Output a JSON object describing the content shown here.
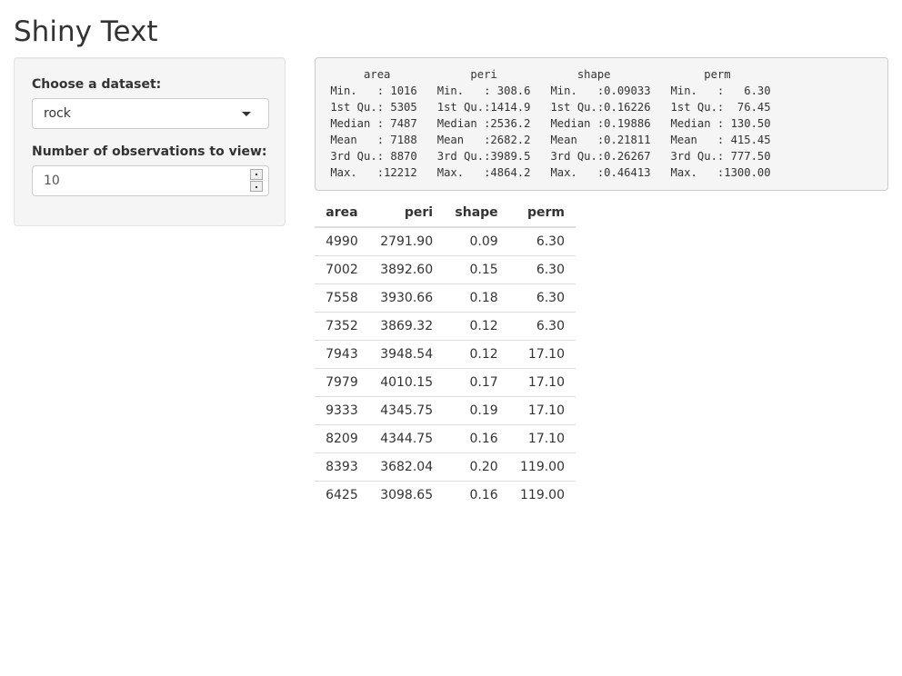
{
  "title": "Shiny Text",
  "sidebar": {
    "dataset_label": "Choose a dataset:",
    "dataset_value": "rock",
    "obs_label": "Number of observations to view:",
    "obs_value": "10"
  },
  "summary": {
    "text": "      area            peri            shape              perm        \n Min.   : 1016   Min.   : 308.6   Min.   :0.09033   Min.   :   6.30  \n 1st Qu.: 5305   1st Qu.:1414.9   1st Qu.:0.16226   1st Qu.:  76.45  \n Median : 7487   Median :2536.2   Median :0.19886   Median : 130.50  \n Mean   : 7188   Mean   :2682.2   Mean   :0.21811   Mean   : 415.45  \n 3rd Qu.: 8870   3rd Qu.:3989.5   3rd Qu.:0.26267   3rd Qu.: 777.50  \n Max.   :12212   Max.   :4864.2   Max.   :0.46413   Max.   :1300.00  "
  },
  "table": {
    "headers": [
      "area",
      "peri",
      "shape",
      "perm"
    ],
    "rows": [
      [
        "4990",
        "2791.90",
        "0.09",
        "6.30"
      ],
      [
        "7002",
        "3892.60",
        "0.15",
        "6.30"
      ],
      [
        "7558",
        "3930.66",
        "0.18",
        "6.30"
      ],
      [
        "7352",
        "3869.32",
        "0.12",
        "6.30"
      ],
      [
        "7943",
        "3948.54",
        "0.12",
        "17.10"
      ],
      [
        "7979",
        "4010.15",
        "0.17",
        "17.10"
      ],
      [
        "9333",
        "4345.75",
        "0.19",
        "17.10"
      ],
      [
        "8209",
        "4344.75",
        "0.16",
        "17.10"
      ],
      [
        "8393",
        "3682.04",
        "0.20",
        "119.00"
      ],
      [
        "6425",
        "3098.65",
        "0.16",
        "119.00"
      ]
    ]
  },
  "icons": {
    "dropdown": "chevron-down-icon",
    "spinner_up": "spinner-up-icon",
    "spinner_down": "spinner-down-icon"
  },
  "colors": {
    "text": "#333333",
    "well_background": "#f5f5f5",
    "border": "#cccccc"
  }
}
